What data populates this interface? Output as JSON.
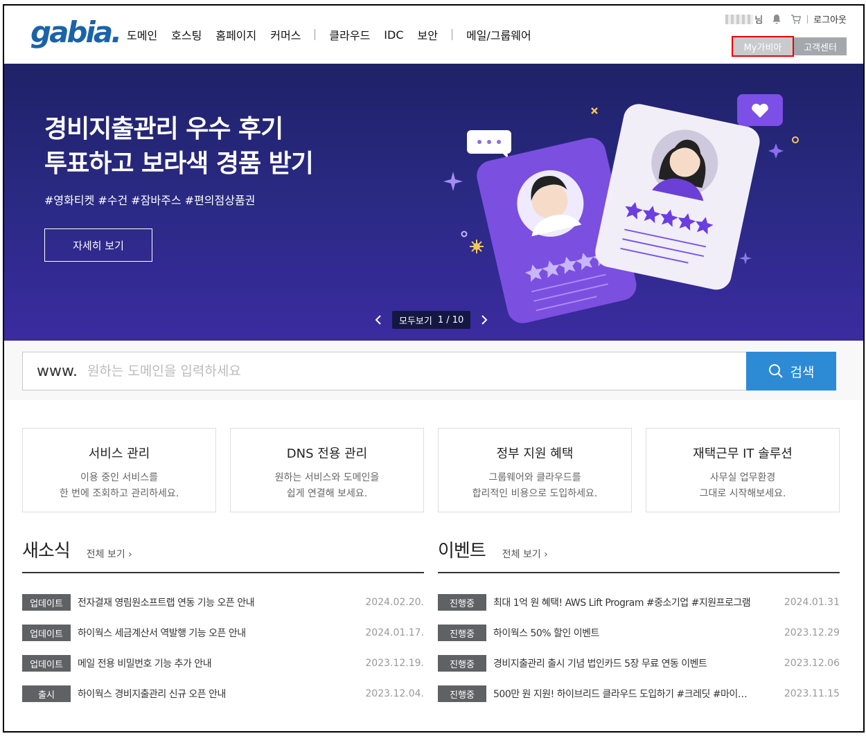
{
  "header": {
    "logo": "gabia.",
    "nav": [
      {
        "label": "도메인"
      },
      {
        "label": "호스팅"
      },
      {
        "label": "홈페이지"
      },
      {
        "label": "커머스"
      },
      {
        "label": "클라우드"
      },
      {
        "label": "IDC"
      },
      {
        "label": "보안"
      },
      {
        "label": "메일/그룹웨어"
      }
    ],
    "user_suffix": "님",
    "logout": "로그아웃",
    "my_button": "My가비아",
    "cs_button": "고객센터"
  },
  "banner": {
    "title_line1": "경비지출관리 우수 후기",
    "title_line2": "투표하고 보라색 경품 받기",
    "tags": "#영화티켓 #수건 #잠바주스 #편의점상품권",
    "button": "자세히 보기",
    "pager_label": "모두보기",
    "pager_count": "1 / 10",
    "colors": {
      "bg_top": "#1f2168",
      "bg_bottom": "#3b2ba0",
      "card_purple": "#7b4fe0"
    }
  },
  "search": {
    "prefix": "www.",
    "placeholder": "원하는 도메인을 입력하세요",
    "value": "",
    "button": "검색",
    "accent": "#2d8bd6"
  },
  "cards": [
    {
      "title": "서비스 관리",
      "desc1": "이용 중인 서비스를",
      "desc2": "한 번에 조회하고 관리하세요."
    },
    {
      "title": "DNS 전용 관리",
      "desc1": "원하는 서비스와 도메인을",
      "desc2": "쉽게 연결해 보세요."
    },
    {
      "title": "정부 지원 혜택",
      "desc1": "그룹웨어와 클라우드를",
      "desc2": "합리적인 비용으로 도입하세요."
    },
    {
      "title": "재택근무 IT 솔루션",
      "desc1": "사무실 업무환경",
      "desc2": "그대로 시작해보세요."
    }
  ],
  "news": {
    "title": "새소식",
    "more": "전체 보기 ›",
    "items": [
      {
        "badge": "업데이트",
        "text": "전자결재 영림원소프트랩 연동 기능 오픈 안내",
        "date": "2024.02.20."
      },
      {
        "badge": "업데이트",
        "text": "하이웍스 세금계산서 역발행 기능 오픈 안내",
        "date": "2024.01.17."
      },
      {
        "badge": "업데이트",
        "text": "메일 전용 비밀번호 기능 추가 안내",
        "date": "2023.12.19."
      },
      {
        "badge": "출시",
        "text": "하이웍스 경비지출관리 신규 오픈 안내",
        "date": "2023.12.04."
      }
    ]
  },
  "events": {
    "title": "이벤트",
    "more": "전체 보기 ›",
    "items": [
      {
        "badge": "진행중",
        "text": "최대 1억 원 혜택! AWS Lift Program #중소기업 #지원프로그램",
        "date": "2024.01.31"
      },
      {
        "badge": "진행중",
        "text": "하이웍스 50% 할인 이벤트",
        "date": "2023.12.29"
      },
      {
        "badge": "진행중",
        "text": "경비지출관리 출시 기념 법인카드 5장 무료 연동 이벤트",
        "date": "2023.12.06"
      },
      {
        "badge": "진행중",
        "text": "500만 원 지원! 하이브리드 클라우드 도입하기 #크레딧 #마이…",
        "date": "2023.11.15"
      }
    ]
  }
}
